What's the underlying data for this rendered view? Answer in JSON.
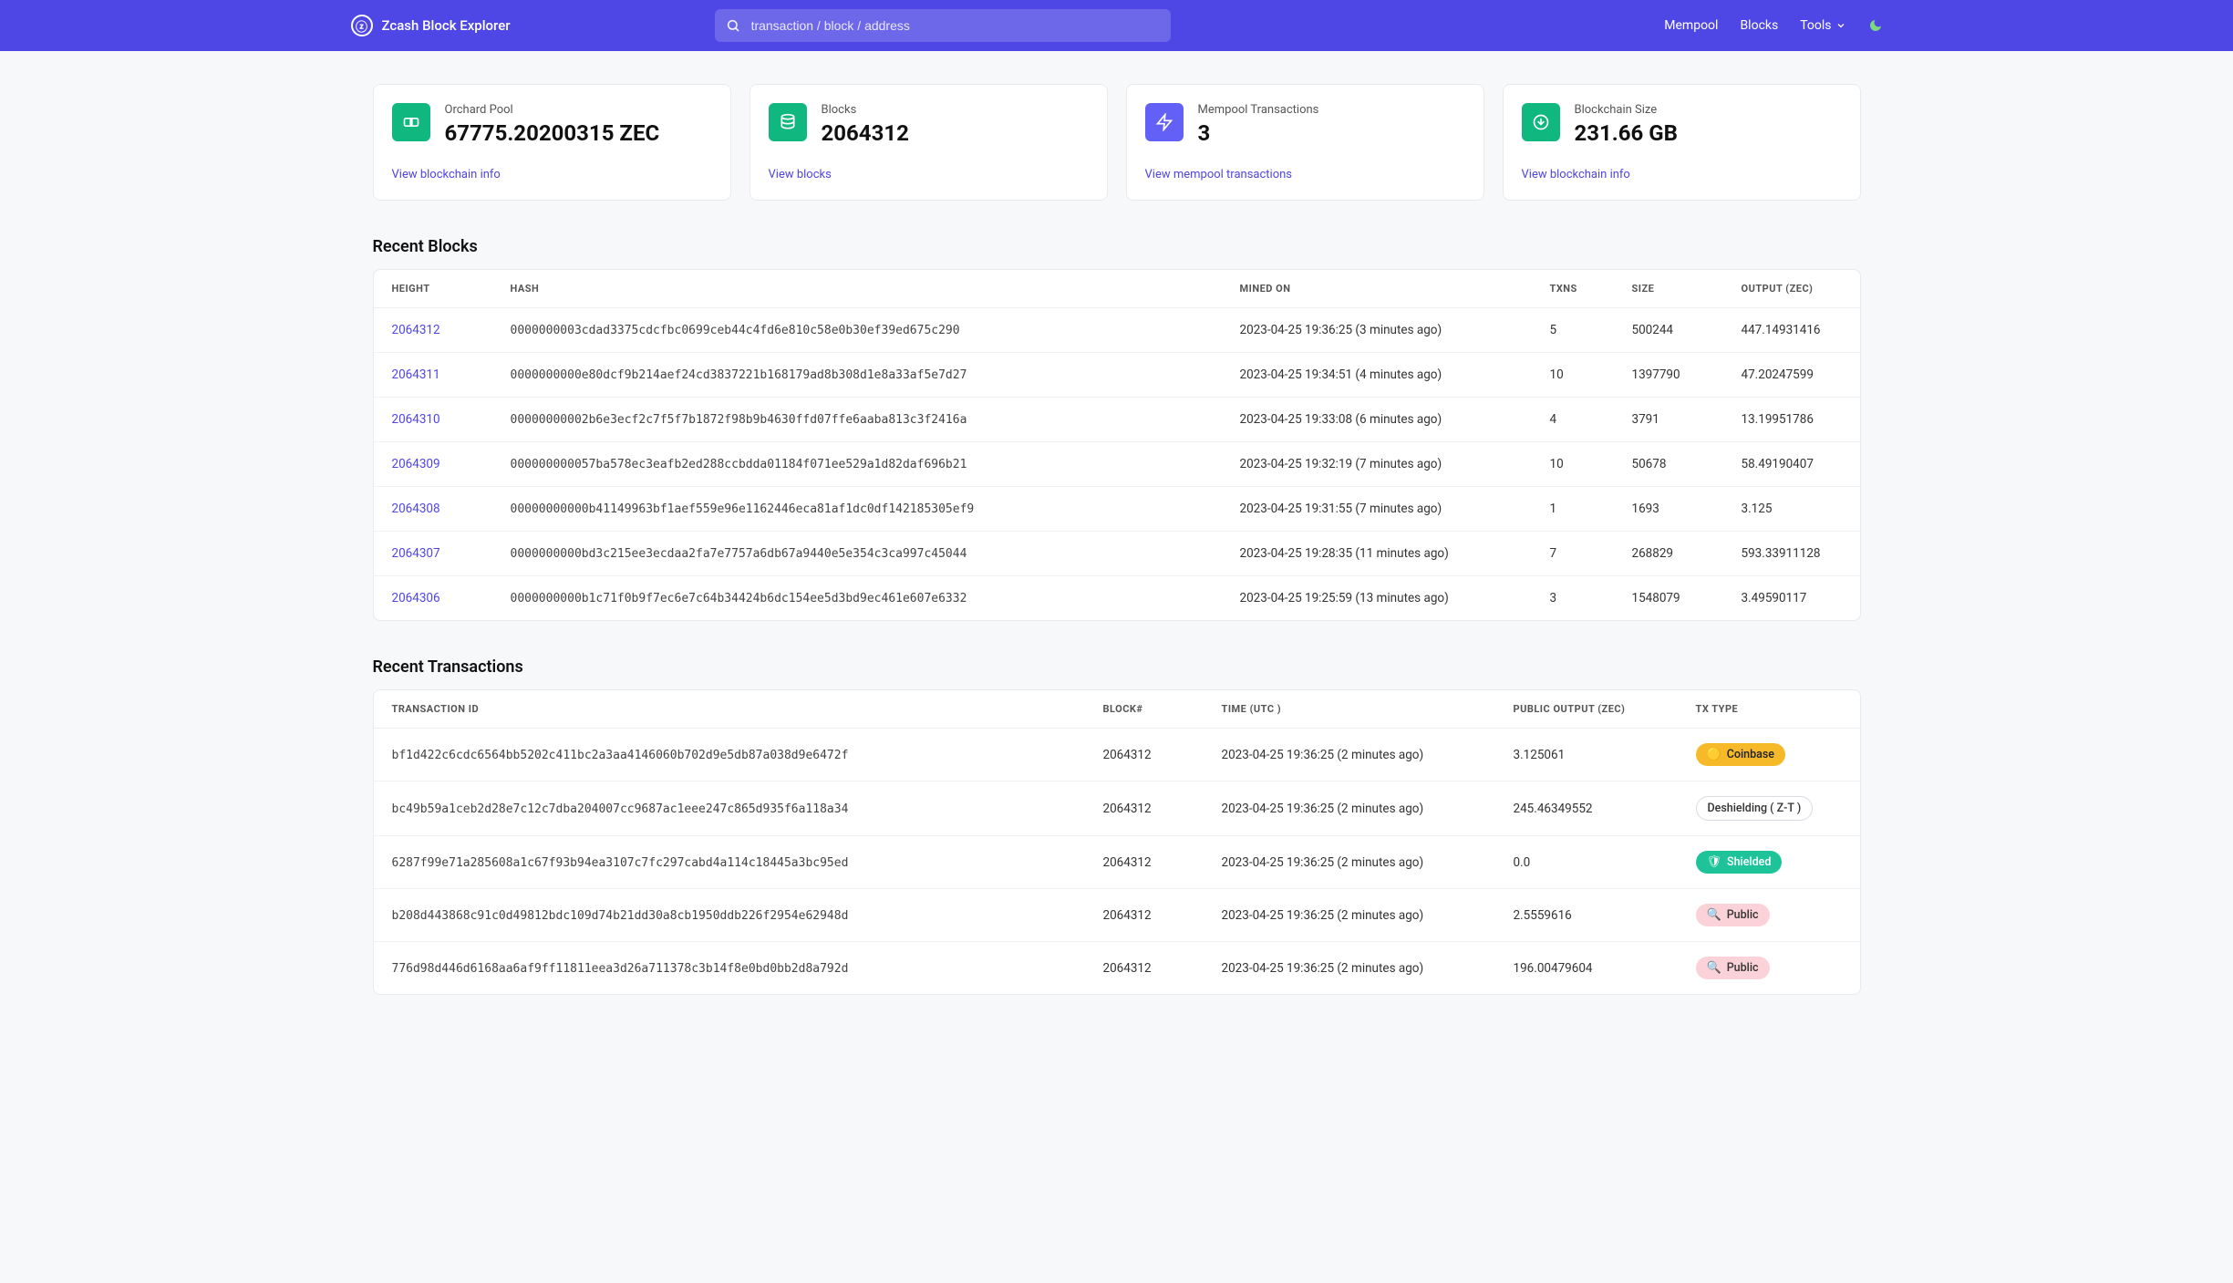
{
  "header": {
    "title": "Zcash Block Explorer",
    "search_placeholder": "transaction / block / address",
    "nav": {
      "mempool": "Mempool",
      "blocks": "Blocks",
      "tools": "Tools"
    }
  },
  "cards": [
    {
      "icon": "link-icon",
      "color": "green",
      "label": "Orchard Pool",
      "value": "67775.20200315 ZEC",
      "link": "View blockchain info"
    },
    {
      "icon": "db-icon",
      "color": "green",
      "label": "Blocks",
      "value": "2064312",
      "link": "View blocks"
    },
    {
      "icon": "bolt-icon",
      "color": "purple",
      "label": "Mempool Transactions",
      "value": "3",
      "link": "View mempool transactions"
    },
    {
      "icon": "download-icon",
      "color": "green",
      "label": "Blockchain Size",
      "value": "231.66 GB",
      "link": "View blockchain info"
    }
  ],
  "blocks_section": {
    "title": "Recent Blocks",
    "headers": {
      "height": "HEIGHT",
      "hash": "HASH",
      "mined": "MINED ON",
      "txns": "TXNS",
      "size": "SIZE",
      "output": "OUTPUT (ZEC)"
    },
    "rows": [
      {
        "height": "2064312",
        "hash": "0000000003cdad3375cdcfbc0699ceb44c4fd6e810c58e0b30ef39ed675c290",
        "mined": "2023-04-25 19:36:25 (3 minutes ago)",
        "txns": "5",
        "size": "500244",
        "output": "447.14931416"
      },
      {
        "height": "2064311",
        "hash": "0000000000e80dcf9b214aef24cd3837221b168179ad8b308d1e8a33af5e7d27",
        "mined": "2023-04-25 19:34:51 (4 minutes ago)",
        "txns": "10",
        "size": "1397790",
        "output": "47.20247599"
      },
      {
        "height": "2064310",
        "hash": "00000000002b6e3ecf2c7f5f7b1872f98b9b4630ffd07ffe6aaba813c3f2416a",
        "mined": "2023-04-25 19:33:08 (6 minutes ago)",
        "txns": "4",
        "size": "3791",
        "output": "13.19951786"
      },
      {
        "height": "2064309",
        "hash": "000000000057ba578ec3eafb2ed288ccbdda01184f071ee529a1d82daf696b21",
        "mined": "2023-04-25 19:32:19 (7 minutes ago)",
        "txns": "10",
        "size": "50678",
        "output": "58.49190407"
      },
      {
        "height": "2064308",
        "hash": "00000000000b41149963bf1aef559e96e1162446eca81af1dc0df142185305ef9",
        "mined": "2023-04-25 19:31:55 (7 minutes ago)",
        "txns": "1",
        "size": "1693",
        "output": "3.125"
      },
      {
        "height": "2064307",
        "hash": "0000000000bd3c215ee3ecdaa2fa7e7757a6db67a9440e5e354c3ca997c45044",
        "mined": "2023-04-25 19:28:35 (11 minutes ago)",
        "txns": "7",
        "size": "268829",
        "output": "593.33911128"
      },
      {
        "height": "2064306",
        "hash": "0000000000b1c71f0b9f7ec6e7c64b34424b6dc154ee5d3bd9ec461e607e6332",
        "mined": "2023-04-25 19:25:59 (13 minutes ago)",
        "txns": "3",
        "size": "1548079",
        "output": "3.49590117"
      }
    ]
  },
  "txs_section": {
    "title": "Recent Transactions",
    "headers": {
      "txid": "TRANSACTION ID",
      "block": "BLOCK#",
      "time": "TIME (UTC )",
      "pout": "PUBLIC OUTPUT (ZEC)",
      "type": "TX TYPE"
    },
    "rows": [
      {
        "txid": "bf1d422c6cdc6564bb5202c411bc2a3aa4146060b702d9e5db87a038d9e6472f",
        "block": "2064312",
        "time": "2023-04-25 19:36:25 (2 minutes ago)",
        "pout": "3.125061",
        "type": "Coinbase",
        "type_class": "coinbase"
      },
      {
        "txid": "bc49b59a1ceb2d28e7c12c7dba204007cc9687ac1eee247c865d935f6a118a34",
        "block": "2064312",
        "time": "2023-04-25 19:36:25 (2 minutes ago)",
        "pout": "245.46349552",
        "type": "Deshielding ( Z-T )",
        "type_class": "deshield"
      },
      {
        "txid": "6287f99e71a285608a1c67f93b94ea3107c7fc297cabd4a114c18445a3bc95ed",
        "block": "2064312",
        "time": "2023-04-25 19:36:25 (2 minutes ago)",
        "pout": "0.0",
        "type": "Shielded",
        "type_class": "shielded"
      },
      {
        "txid": "b208d443868c91c0d49812bdc109d74b21dd30a8cb1950ddb226f2954e62948d",
        "block": "2064312",
        "time": "2023-04-25 19:36:25 (2 minutes ago)",
        "pout": "2.5559616",
        "type": "Public",
        "type_class": "public"
      },
      {
        "txid": "776d98d446d6168aa6af9ff11811eea3d26a711378c3b14f8e0bd0bb2d8a792d",
        "block": "2064312",
        "time": "2023-04-25 19:36:25 (2 minutes ago)",
        "pout": "196.00479604",
        "type": "Public",
        "type_class": "public"
      }
    ]
  }
}
